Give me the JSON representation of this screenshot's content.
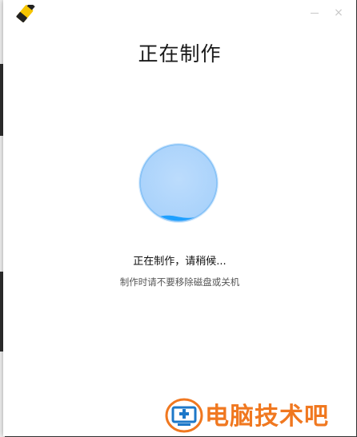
{
  "window": {
    "title": "正在制作",
    "controls": {
      "minimize": "minimize",
      "close": "×"
    }
  },
  "progress": {
    "state": "in-progress",
    "fill_fraction": 0.06,
    "colors": {
      "fill": "#b5d8fb",
      "ring": "#6cb4f4",
      "wave": "#1ea0ff"
    }
  },
  "status_text": "正在制作，请稍候...",
  "hint_text": "制作时请不要移除磁盘或关机",
  "watermark": {
    "text": "电脑技术吧"
  },
  "colors": {
    "accent": "#f07820",
    "app_icon": "#f5c400"
  }
}
